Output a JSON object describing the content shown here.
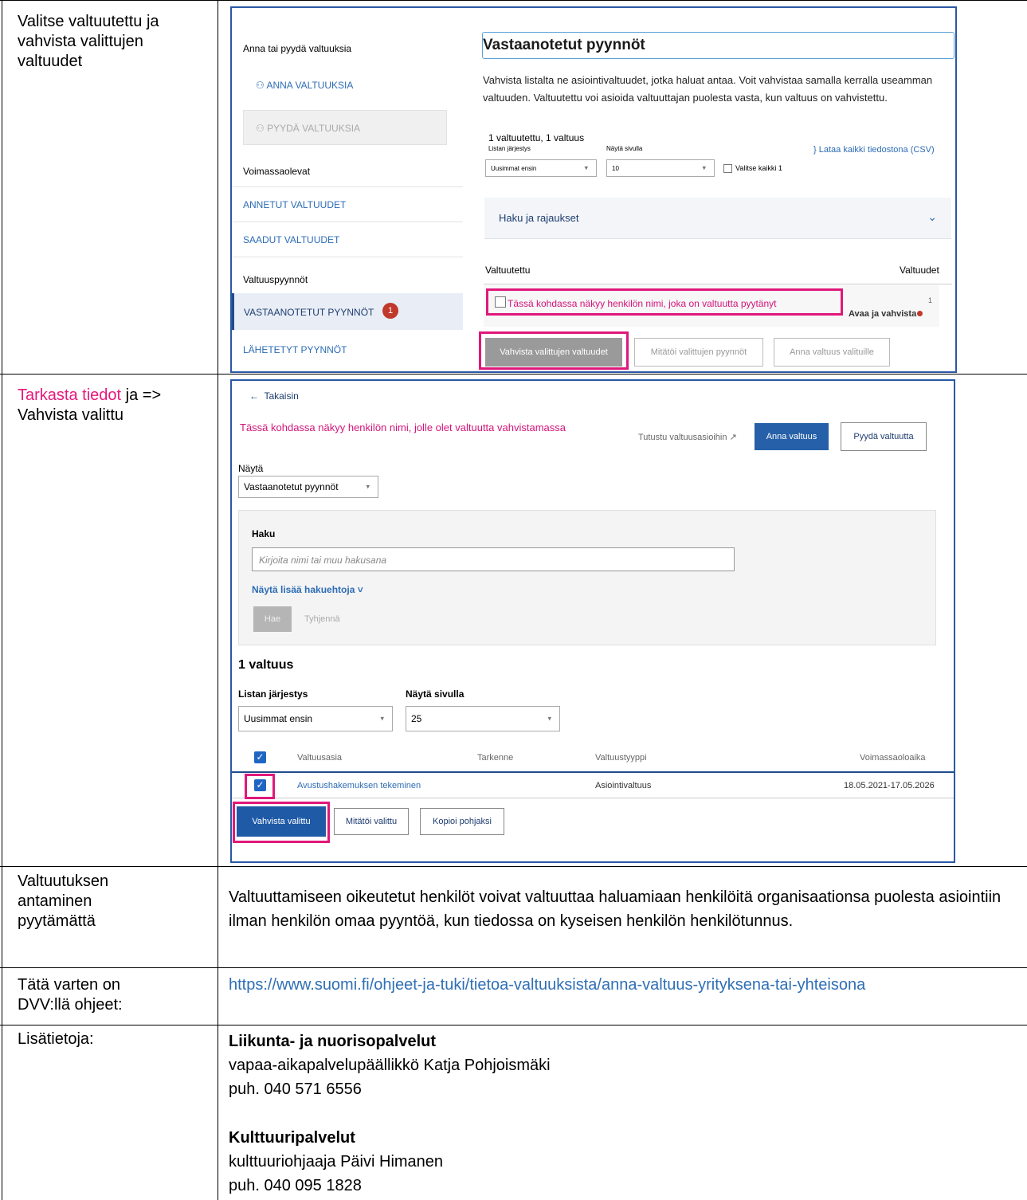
{
  "rows": {
    "r1_label": "Valitse valtuutettu ja\nvahvista valittujen\nvaltuudet",
    "r2_label_pink": "Tarkasta tiedot",
    "r2_label_rest": " ja =>\nVahvista valittu",
    "r3_label": "Valtuutuksen\nantaminen\npyytämättä",
    "r3_body": "Valtuuttamiseen oikeutetut henkilöt voivat valtuuttaa haluamiaan henkilöitä organisaationsa puolesta asiointiin ilman henkilön omaa pyyntöä, kun tiedossa on kyseisen henkilön henkilötunnus.",
    "r4_label": "Tätä varten on\nDVV:llä ohjeet:",
    "r4_link": "https://www.suomi.fi/ohjeet-ja-tuki/tietoa-valtuuksista/anna-valtuus-yrityksena-tai-yhteisona",
    "r5_label": "Lisätietoja:",
    "c1_head": "Liikunta- ja nuorisopalvelut",
    "c1_line1": "vapaa-aikapalvelupäällikkö Katja Pohjoismäki",
    "c1_line2": "puh. 040 571 6556",
    "c2_head": "Kulttuuripalvelut",
    "c2_line1": "kulttuuriohjaaja Päivi Himanen",
    "c2_line2": "puh. 040 095 1828"
  },
  "shot1": {
    "side_heading": "Anna tai pyydä valtuuksia",
    "btn_anna": "ANNA VALTUUKSIA",
    "btn_pyyda": "PYYDÄ VALTUUKSIA",
    "sec_voimassa": "Voimassaolevat",
    "nav_annetut": "ANNETUT VALTUUDET",
    "nav_saadut": "SAADUT VALTUUDET",
    "sec_pyynnot": "Valtuuspyynnöt",
    "nav_vastaanotetut": "VASTAANOTETUT PYYNNÖT",
    "badge": "1",
    "nav_lahetetyt": "LÄHETETYT PYYNNÖT",
    "title": "Vastaanotetut pyynnöt",
    "intro": "Vahvista listalta ne asiointivaltuudet, jotka haluat antaa. Voit vahvistaa samalla kerralla useamman valtuuden. Valtuutettu voi asioida valtuuttajan puolesta vasta, kun valtuus on vahvistettu.",
    "count": "1 valtuutettu, 1 valtuus",
    "sort_label": "Listan järjestys",
    "sort_value": "Uusimmat ensin",
    "page_label": "Näytä sivulla",
    "page_value": "10",
    "select_all": "Valitse kaikki 1",
    "csv": "Lataa kaikki tiedostona (CSV)",
    "filter": "Haku ja rajaukset",
    "col_left": "Valtuutettu",
    "col_right": "Valtuudet",
    "row_name": "Tässä kohdassa näkyy henkilön nimi, joka on valtuutta pyytänyt",
    "row_count": "1",
    "row_action": "Avaa ja vahvista",
    "btn_confirm": "Vahvista valittujen valtuudet",
    "btn_cancel": "Mitätöi valittujen pyynnöt",
    "btn_give": "Anna valtuus valituille"
  },
  "shot2": {
    "back": "Takaisin",
    "person": "Tässä kohdassa näkyy henkilön nimi, jolle olet valtuutta vahvistamassa",
    "learn": "Tutustu valtuusasioihin",
    "btn_give": "Anna valtuus",
    "btn_request": "Pyydä valtuutta",
    "show_label": "Näytä",
    "show_value": "Vastaanotetut pyynnöt",
    "search_label": "Haku",
    "search_placeholder": "Kirjoita nimi tai muu hakusana",
    "more": "Näytä lisää hakuehtoja",
    "btn_search": "Hae",
    "btn_clear": "Tyhjennä",
    "count": "1 valtuus",
    "sort_label": "Listan järjestys",
    "sort_value": "Uusimmat ensin",
    "page_label": "Näytä sivulla",
    "page_value": "25",
    "col1": "Valtuusasia",
    "col2": "Tarkenne",
    "col3": "Valtuustyyppi",
    "col4": "Voimassaoloaika",
    "row_matter": "Avustushakemuksen tekeminen",
    "row_type": "Asiointivaltuus",
    "row_period": "18.05.2021-17.05.2026",
    "btn_confirm": "Vahvista valittu",
    "btn_cancel": "Mitätöi valittu",
    "btn_copy": "Kopioi pohjaksi"
  }
}
